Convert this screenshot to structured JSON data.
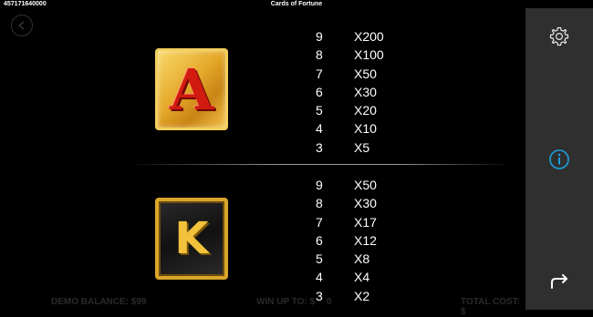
{
  "header": {
    "id_number": "457171640000",
    "title": "Cards of Fortune"
  },
  "symbols": [
    {
      "name": "A",
      "payouts": [
        {
          "count": "9",
          "multiplier": "X200"
        },
        {
          "count": "8",
          "multiplier": "X100"
        },
        {
          "count": "7",
          "multiplier": "X50"
        },
        {
          "count": "6",
          "multiplier": "X30"
        },
        {
          "count": "5",
          "multiplier": "X20"
        },
        {
          "count": "4",
          "multiplier": "X10"
        },
        {
          "count": "3",
          "multiplier": "X5"
        }
      ]
    },
    {
      "name": "K",
      "payouts": [
        {
          "count": "9",
          "multiplier": "X50"
        },
        {
          "count": "8",
          "multiplier": "X30"
        },
        {
          "count": "7",
          "multiplier": "X17"
        },
        {
          "count": "6",
          "multiplier": "X12"
        },
        {
          "count": "5",
          "multiplier": "X8"
        },
        {
          "count": "4",
          "multiplier": "X4"
        },
        {
          "count": "3",
          "multiplier": "X2"
        }
      ]
    }
  ],
  "footer": {
    "balance_label": "DEMO BALANCE: $99",
    "win_label": "WIN UP TO: $",
    "win_value_partial": "0",
    "total_cost_label": "TOTAL COST: $"
  },
  "sidebar": {
    "icons": [
      "gear-icon",
      "info-icon",
      "return-arrow-icon"
    ],
    "accent": "#1da1e0"
  }
}
